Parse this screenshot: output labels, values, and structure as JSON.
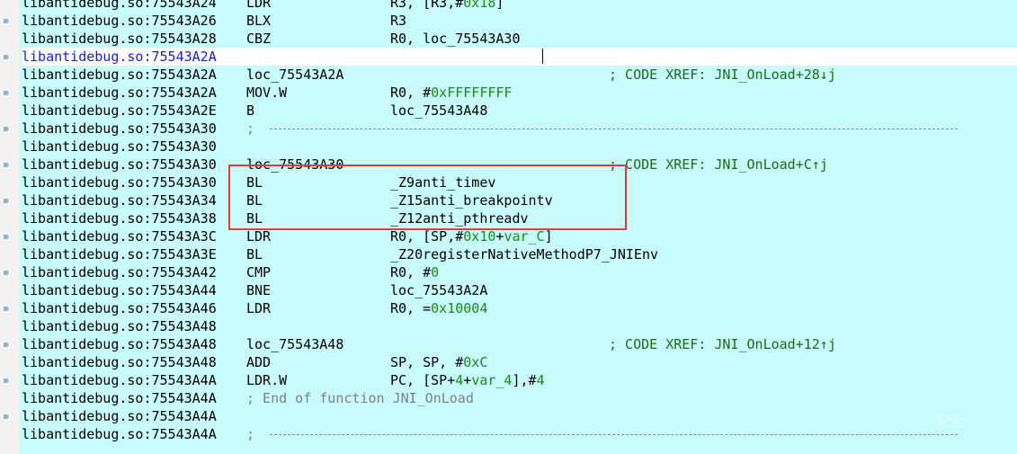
{
  "listing": [
    {
      "addr": "libantidebug.so:75543A24",
      "mnem": "LDR",
      "ops": "R3, [R3,#",
      "ops_num": "0x18",
      "ops_tail": "]"
    },
    {
      "addr": "libantidebug.so:75543A26",
      "mnem": "BLX",
      "ops": "R3"
    },
    {
      "addr": "libantidebug.so:75543A28",
      "mnem": "CBZ",
      "ops": "R0, loc_75543A30"
    },
    {
      "addr": "libantidebug.so:75543A2A",
      "mnem": "",
      "ops": "",
      "blue": true,
      "selected": true
    },
    {
      "addr": "libantidebug.so:75543A2A",
      "mnem": "loc_75543A2A",
      "ops": "",
      "xref": "; CODE XREF: JNI_OnLoad+28↓j"
    },
    {
      "addr": "libantidebug.so:75543A2A",
      "mnem": "MOV.W",
      "ops": "R0, #",
      "ops_num": "0xFFFFFFFF"
    },
    {
      "addr": "libantidebug.so:75543A2E",
      "mnem": "B",
      "ops": "loc_75543A48"
    },
    {
      "addr": "libantidebug.so:75543A30",
      "separator": true
    },
    {
      "addr": "libantidebug.so:75543A30",
      "mnem": "",
      "ops": ""
    },
    {
      "addr": "libantidebug.so:75543A30",
      "mnem": "loc_75543A30",
      "ops": "",
      "xref": "; CODE XREF: JNI_OnLoad+C↑j"
    },
    {
      "addr": "libantidebug.so:75543A30",
      "mnem": "BL",
      "ops": "_Z9anti_timev"
    },
    {
      "addr": "libantidebug.so:75543A34",
      "mnem": "BL",
      "ops": "_Z15anti_breakpointv"
    },
    {
      "addr": "libantidebug.so:75543A38",
      "mnem": "BL",
      "ops": "_Z12anti_pthreadv"
    },
    {
      "addr": "libantidebug.so:75543A3C",
      "mnem": "LDR",
      "ops": "R0, [SP,#",
      "ops_num": "0x10",
      "ops_tail": "+",
      "ops_var": "var_C",
      "ops_end": "]"
    },
    {
      "addr": "libantidebug.so:75543A3E",
      "mnem": "BL",
      "ops": "_Z20registerNativeMethodP7_JNIEnv"
    },
    {
      "addr": "libantidebug.so:75543A42",
      "mnem": "CMP",
      "ops": "R0, #",
      "ops_num": "0"
    },
    {
      "addr": "libantidebug.so:75543A44",
      "mnem": "BNE",
      "ops": "loc_75543A2A"
    },
    {
      "addr": "libantidebug.so:75543A46",
      "mnem": "LDR",
      "ops": "R0, =",
      "ops_num": "0x10004"
    },
    {
      "addr": "libantidebug.so:75543A48",
      "mnem": "",
      "ops": ""
    },
    {
      "addr": "libantidebug.so:75543A48",
      "mnem": "loc_75543A48",
      "ops": "",
      "xref": "; CODE XREF: JNI_OnLoad+12↑j"
    },
    {
      "addr": "libantidebug.so:75543A48",
      "mnem": "ADD",
      "ops": "SP, SP, #",
      "ops_num": "0xC"
    },
    {
      "addr": "libantidebug.so:75543A4A",
      "mnem": "LDR.W",
      "ops": "PC, [SP+",
      "ops_num": "4",
      "ops_tail": "+",
      "ops_var": "var_4",
      "ops_end": "],#",
      "ops_num2": "4"
    },
    {
      "addr": "libantidebug.so:75543A4A",
      "comment": "; End of function JNI_OnLoad"
    },
    {
      "addr": "libantidebug.so:75543A4A",
      "mnem": "",
      "ops": ""
    },
    {
      "addr": "libantidebug.so:75543A4A",
      "separator": true
    }
  ],
  "watermark": "安全",
  "colors": {
    "background": "#c8fbfb",
    "highlight_box": "#e23b3b",
    "number": "#1a8a1a",
    "xref": "#1a6b1a",
    "comment": "#808080"
  }
}
